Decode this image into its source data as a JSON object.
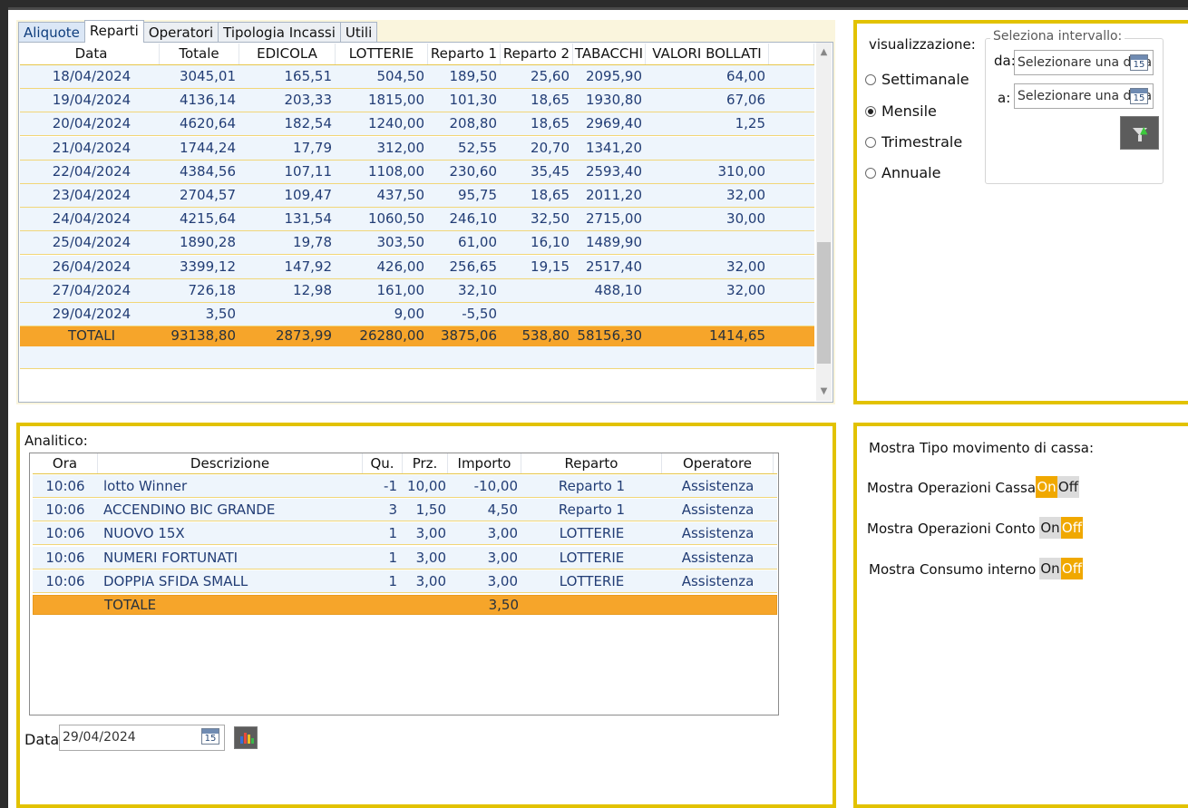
{
  "tabs": [
    "Aliquote",
    "Reparti",
    "Operatori",
    "Tipologia Incassi",
    "Utili"
  ],
  "active_tab": "Reparti",
  "reparti_table": {
    "columns": [
      "Data",
      "Totale",
      "EDICOLA",
      "LOTTERIE",
      "Reparto 1",
      "Reparto 2",
      "TABACCHI",
      "VALORI BOLLATI"
    ],
    "rows": [
      [
        "18/04/2024",
        "3045,01",
        "165,51",
        "504,50",
        "189,50",
        "25,60",
        "2095,90",
        "64,00"
      ],
      [
        "19/04/2024",
        "4136,14",
        "203,33",
        "1815,00",
        "101,30",
        "18,65",
        "1930,80",
        "67,06"
      ],
      [
        "20/04/2024",
        "4620,64",
        "182,54",
        "1240,00",
        "208,80",
        "18,65",
        "2969,40",
        "1,25"
      ],
      [
        "21/04/2024",
        "1744,24",
        "17,79",
        "312,00",
        "52,55",
        "20,70",
        "1341,20",
        ""
      ],
      [
        "22/04/2024",
        "4384,56",
        "107,11",
        "1108,00",
        "230,60",
        "35,45",
        "2593,40",
        "310,00"
      ],
      [
        "23/04/2024",
        "2704,57",
        "109,47",
        "437,50",
        "95,75",
        "18,65",
        "2011,20",
        "32,00"
      ],
      [
        "24/04/2024",
        "4215,64",
        "131,54",
        "1060,50",
        "246,10",
        "32,50",
        "2715,00",
        "30,00"
      ],
      [
        "25/04/2024",
        "1890,28",
        "19,78",
        "303,50",
        "61,00",
        "16,10",
        "1489,90",
        ""
      ],
      [
        "26/04/2024",
        "3399,12",
        "147,92",
        "426,00",
        "256,65",
        "19,15",
        "2517,40",
        "32,00"
      ],
      [
        "27/04/2024",
        "726,18",
        "12,98",
        "161,00",
        "32,10",
        "",
        "488,10",
        "32,00"
      ],
      [
        "29/04/2024",
        "3,50",
        "",
        "9,00",
        "-5,50",
        "",
        "",
        ""
      ]
    ],
    "totals": [
      "TOTALI",
      "93138,80",
      "2873,99",
      "26280,00",
      "3875,06",
      "538,80",
      "58156,30",
      "1414,65"
    ]
  },
  "visualizzazione": {
    "label": "visualizzazione:",
    "options": [
      "Settimanale",
      "Mensile",
      "Trimestrale",
      "Annuale"
    ],
    "selected": "Mensile"
  },
  "intervallo": {
    "title": "Seleziona intervallo:",
    "da_label": "da:",
    "a_label": "a:",
    "da_placeholder": "Selezionare una data",
    "a_placeholder": "Selezionare una data"
  },
  "analitico": {
    "label": "Analitico:",
    "columns": [
      "Ora",
      "Descrizione",
      "Qu.",
      "Prz.",
      "Importo",
      "Reparto",
      "Operatore"
    ],
    "rows": [
      [
        "10:06",
        "lotto Winner",
        "-1",
        "10,00",
        "-10,00",
        "Reparto 1",
        "Assistenza"
      ],
      [
        "10:06",
        "ACCENDINO BIC GRANDE",
        "3",
        "1,50",
        "4,50",
        "Reparto 1",
        "Assistenza"
      ],
      [
        "10:06",
        "NUOVO 15X",
        "1",
        "3,00",
        "3,00",
        "LOTTERIE",
        "Assistenza"
      ],
      [
        "10:06",
        "NUMERI FORTUNATI",
        "1",
        "3,00",
        "3,00",
        "LOTTERIE",
        "Assistenza"
      ],
      [
        "10:06",
        "DOPPIA SFIDA SMALL",
        "1",
        "3,00",
        "3,00",
        "LOTTERIE",
        "Assistenza"
      ]
    ],
    "total_label": "TOTALE",
    "total_value": "3,50",
    "data_label": "Data",
    "data_value": "29/04/2024"
  },
  "movimento": {
    "title": "Mostra Tipo movimento di cassa:",
    "items": [
      {
        "label": "Mostra Operazioni Cassa",
        "state": "On"
      },
      {
        "label": "Mostra Operazioni Conto",
        "state": "Off"
      },
      {
        "label": "Mostra Consumo interno",
        "state": "Off"
      }
    ],
    "on_label": "On",
    "off_label": "Off"
  },
  "calendar_day": "15",
  "colors": {
    "panel_border": "#e2c200",
    "totals_row": "#f6a52a",
    "toggle_selected": "#f0a800",
    "row_text": "#223d75"
  },
  "icons": [
    "calendar-icon",
    "filter-icon",
    "chart-icon",
    "radio-icon",
    "scroll-up-icon",
    "scroll-down-icon"
  ]
}
